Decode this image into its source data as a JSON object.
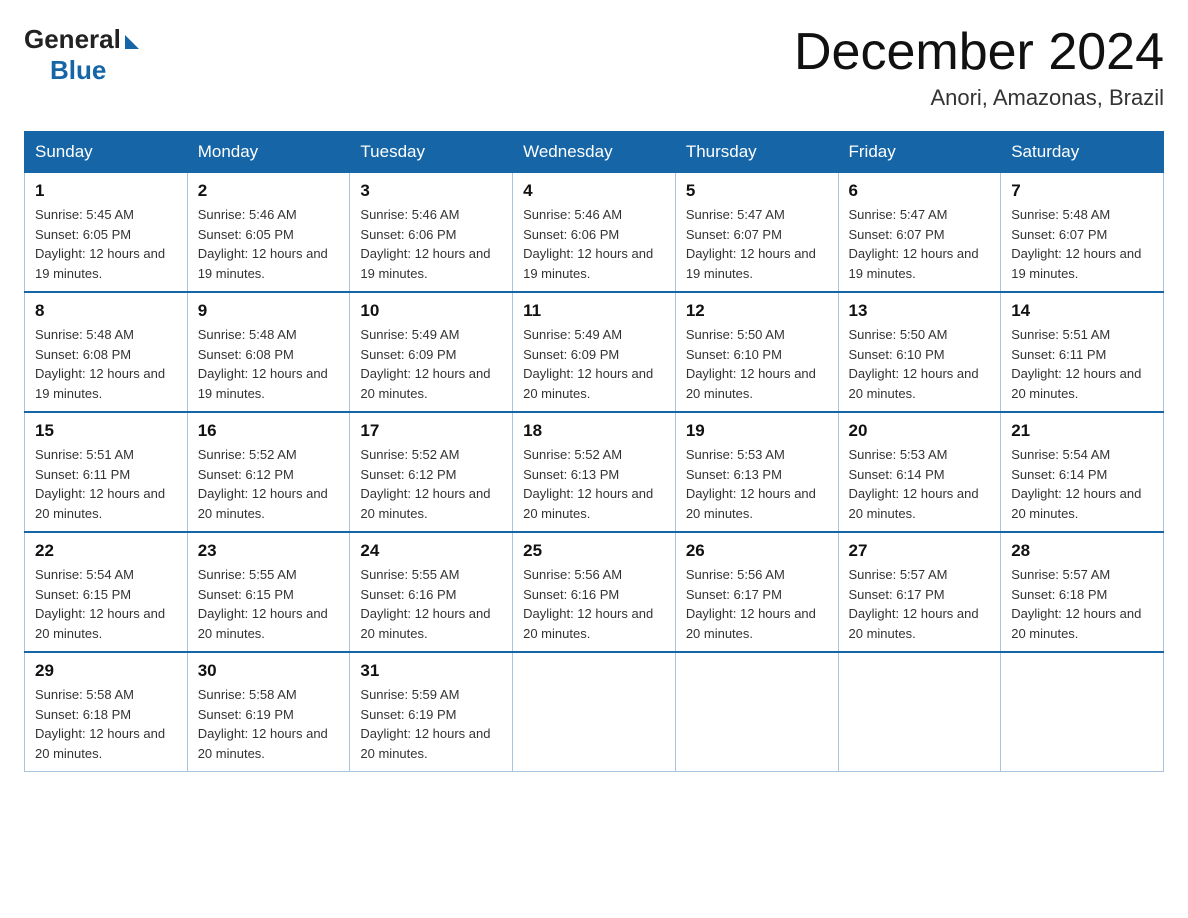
{
  "header": {
    "logo_general": "General",
    "logo_blue": "Blue",
    "month_title": "December 2024",
    "location": "Anori, Amazonas, Brazil"
  },
  "weekdays": [
    "Sunday",
    "Monday",
    "Tuesday",
    "Wednesday",
    "Thursday",
    "Friday",
    "Saturday"
  ],
  "weeks": [
    [
      {
        "day": "1",
        "sunrise": "5:45 AM",
        "sunset": "6:05 PM",
        "daylight": "12 hours and 19 minutes."
      },
      {
        "day": "2",
        "sunrise": "5:46 AM",
        "sunset": "6:05 PM",
        "daylight": "12 hours and 19 minutes."
      },
      {
        "day": "3",
        "sunrise": "5:46 AM",
        "sunset": "6:06 PM",
        "daylight": "12 hours and 19 minutes."
      },
      {
        "day": "4",
        "sunrise": "5:46 AM",
        "sunset": "6:06 PM",
        "daylight": "12 hours and 19 minutes."
      },
      {
        "day": "5",
        "sunrise": "5:47 AM",
        "sunset": "6:07 PM",
        "daylight": "12 hours and 19 minutes."
      },
      {
        "day": "6",
        "sunrise": "5:47 AM",
        "sunset": "6:07 PM",
        "daylight": "12 hours and 19 minutes."
      },
      {
        "day": "7",
        "sunrise": "5:48 AM",
        "sunset": "6:07 PM",
        "daylight": "12 hours and 19 minutes."
      }
    ],
    [
      {
        "day": "8",
        "sunrise": "5:48 AM",
        "sunset": "6:08 PM",
        "daylight": "12 hours and 19 minutes."
      },
      {
        "day": "9",
        "sunrise": "5:48 AM",
        "sunset": "6:08 PM",
        "daylight": "12 hours and 19 minutes."
      },
      {
        "day": "10",
        "sunrise": "5:49 AM",
        "sunset": "6:09 PM",
        "daylight": "12 hours and 20 minutes."
      },
      {
        "day": "11",
        "sunrise": "5:49 AM",
        "sunset": "6:09 PM",
        "daylight": "12 hours and 20 minutes."
      },
      {
        "day": "12",
        "sunrise": "5:50 AM",
        "sunset": "6:10 PM",
        "daylight": "12 hours and 20 minutes."
      },
      {
        "day": "13",
        "sunrise": "5:50 AM",
        "sunset": "6:10 PM",
        "daylight": "12 hours and 20 minutes."
      },
      {
        "day": "14",
        "sunrise": "5:51 AM",
        "sunset": "6:11 PM",
        "daylight": "12 hours and 20 minutes."
      }
    ],
    [
      {
        "day": "15",
        "sunrise": "5:51 AM",
        "sunset": "6:11 PM",
        "daylight": "12 hours and 20 minutes."
      },
      {
        "day": "16",
        "sunrise": "5:52 AM",
        "sunset": "6:12 PM",
        "daylight": "12 hours and 20 minutes."
      },
      {
        "day": "17",
        "sunrise": "5:52 AM",
        "sunset": "6:12 PM",
        "daylight": "12 hours and 20 minutes."
      },
      {
        "day": "18",
        "sunrise": "5:52 AM",
        "sunset": "6:13 PM",
        "daylight": "12 hours and 20 minutes."
      },
      {
        "day": "19",
        "sunrise": "5:53 AM",
        "sunset": "6:13 PM",
        "daylight": "12 hours and 20 minutes."
      },
      {
        "day": "20",
        "sunrise": "5:53 AM",
        "sunset": "6:14 PM",
        "daylight": "12 hours and 20 minutes."
      },
      {
        "day": "21",
        "sunrise": "5:54 AM",
        "sunset": "6:14 PM",
        "daylight": "12 hours and 20 minutes."
      }
    ],
    [
      {
        "day": "22",
        "sunrise": "5:54 AM",
        "sunset": "6:15 PM",
        "daylight": "12 hours and 20 minutes."
      },
      {
        "day": "23",
        "sunrise": "5:55 AM",
        "sunset": "6:15 PM",
        "daylight": "12 hours and 20 minutes."
      },
      {
        "day": "24",
        "sunrise": "5:55 AM",
        "sunset": "6:16 PM",
        "daylight": "12 hours and 20 minutes."
      },
      {
        "day": "25",
        "sunrise": "5:56 AM",
        "sunset": "6:16 PM",
        "daylight": "12 hours and 20 minutes."
      },
      {
        "day": "26",
        "sunrise": "5:56 AM",
        "sunset": "6:17 PM",
        "daylight": "12 hours and 20 minutes."
      },
      {
        "day": "27",
        "sunrise": "5:57 AM",
        "sunset": "6:17 PM",
        "daylight": "12 hours and 20 minutes."
      },
      {
        "day": "28",
        "sunrise": "5:57 AM",
        "sunset": "6:18 PM",
        "daylight": "12 hours and 20 minutes."
      }
    ],
    [
      {
        "day": "29",
        "sunrise": "5:58 AM",
        "sunset": "6:18 PM",
        "daylight": "12 hours and 20 minutes."
      },
      {
        "day": "30",
        "sunrise": "5:58 AM",
        "sunset": "6:19 PM",
        "daylight": "12 hours and 20 minutes."
      },
      {
        "day": "31",
        "sunrise": "5:59 AM",
        "sunset": "6:19 PM",
        "daylight": "12 hours and 20 minutes."
      },
      null,
      null,
      null,
      null
    ]
  ]
}
